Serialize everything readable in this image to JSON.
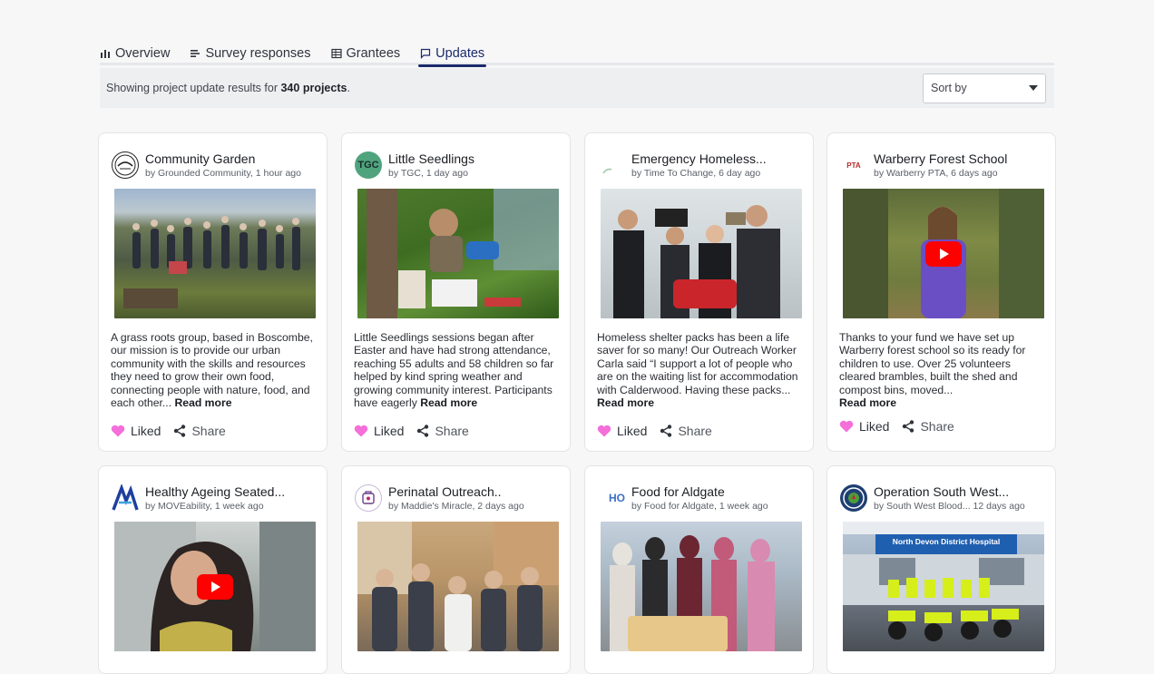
{
  "tabs": [
    {
      "label": "Overview",
      "icon": "bar-chart-icon",
      "active": false
    },
    {
      "label": "Survey responses",
      "icon": "list-icon",
      "active": false
    },
    {
      "label": "Grantees",
      "icon": "table-icon",
      "active": false
    },
    {
      "label": "Updates",
      "icon": "message-icon",
      "active": true
    }
  ],
  "infobar": {
    "prefix": "Showing project update results for",
    "count": "340 projects",
    "suffix": ".",
    "sort_label": "Sort by"
  },
  "actions": {
    "liked_label": "Liked",
    "share_label": "Share",
    "read_more": "Read more"
  },
  "cards": [
    {
      "title": "Community Garden",
      "meta": "by Grounded Community, 1 hour ago",
      "avatar_text": "",
      "video": false,
      "text": "A grass roots group, based in Boscombe, our mission is to provide our urban community with the skills and resources they need to grow their own food, connecting people with nature, food, and each other..."
    },
    {
      "title": "Little Seedlings",
      "meta": "by TGC, 1 day ago",
      "avatar_text": "TGC",
      "video": false,
      "text": "Little Seedlings sessions began after Easter and have had strong attendance, reaching 55 adults and 58 children so far helped by kind spring weather and growing community interest. Participants have eagerly"
    },
    {
      "title": "Emergency Homeless...",
      "meta": "by Time To Change, 6 day ago",
      "avatar_text": "",
      "video": false,
      "text": "Homeless shelter packs has been a life saver for so many! Our Outreach Worker Carla said “I support a lot of people who are on the waiting list for accommodation with Calderwood. Having these packs..."
    },
    {
      "title": "Warberry Forest School",
      "meta": "by Warberry PTA, 6 days ago",
      "avatar_text": "PTA",
      "video": true,
      "text": "Thanks to your fund we have set up Warberry forest school so its ready for children to use. Over 25 volunteers cleared brambles, built the shed and compost bins, moved..."
    },
    {
      "title": "Healthy Ageing Seated...",
      "meta": "by MOVEability, 1 week ago",
      "avatar_text": "",
      "video": true,
      "text": ""
    },
    {
      "title": "Perinatal Outreach..",
      "meta": "by Maddie's Miracle, 2 days ago",
      "avatar_text": "",
      "video": false,
      "text": ""
    },
    {
      "title": "Food for Aldgate",
      "meta": "by Food for Aldgate, 1 week ago",
      "avatar_text": "HO",
      "video": false,
      "text": ""
    },
    {
      "title": "Operation South West...",
      "meta": "by South West Blood... 12 days ago",
      "avatar_text": "",
      "video": false,
      "text": ""
    }
  ],
  "image_captions": {
    "hospital_sign": "North Devon District Hospital"
  },
  "colors": {
    "accent": "#1b2a6b",
    "heart": "#f46fd9",
    "youtube": "#ff0000"
  }
}
